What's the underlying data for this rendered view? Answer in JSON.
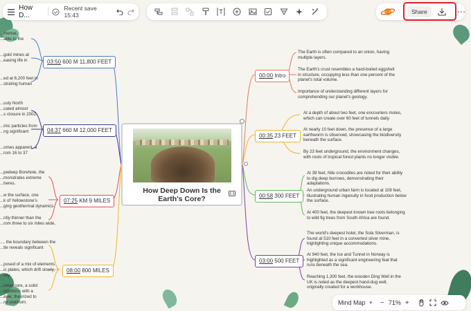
{
  "header": {
    "title": "How D...",
    "save_status": "Recent save 15:43",
    "share_label": "Share"
  },
  "central": {
    "title": "How Deep Down Is the Earth's Core?"
  },
  "right_branches": [
    {
      "time": "00:00",
      "label": "Intro",
      "color": "#e07a5f",
      "notes": [
        "The Earth is often compared to an onion, having multiple layers.",
        "The Earth's crust resembles a hard-boiled eggshell in structure, occupying less than one percent of the planet's total volume.",
        "Importance of understanding different layers for comprehending our planet's geology."
      ]
    },
    {
      "time": "00:35",
      "label": "23 FEET",
      "color": "#f0b429",
      "notes": [
        "At a depth of about two feet, one encounters moles, which can create over 60 feet of tunnels daily.",
        "At nearly 10 feet down, the presence of a large earthworm is observed, showcasing the biodiversity beneath the surface.",
        "By 23 feet underground, the environment changes, with roots of tropical forest plants no longer visible."
      ]
    },
    {
      "time": "00:58",
      "label": "300 FEET",
      "color": "#5cb85c",
      "notes": [
        "At 39 feet, Nile crocodiles are noted for their ability to dig deep burrows, demonstrating their adaptations.",
        "An underground urban farm is located at 108 feet, illustrating human ingenuity in food production below the surface.",
        "At 400 feet, the deepest known tree roots belonging to wild fig trees from South Africa are found."
      ]
    },
    {
      "time": "03:00",
      "label": "500 FEET",
      "color": "#7b3fa0",
      "notes": [
        "The world's deepest hotel, the Sola Silverman, is found at 510 feet in a converted silver mine, highlighting unique accommodations.",
        "At 940 feet, the Ice and Tunnel in Norway is highlighted as a significant engineering feat that runs beneath the sea.",
        "Reaching 1,300 feet, the wooden Ding Well in the UK is noted as the deepest hand-dug well, originally created for a workhouse."
      ]
    }
  ],
  "left_branches": [
    {
      "time": "03:50",
      "label": "600 M 11,800 FEET",
      "color": "#4a78c8",
      "notes": [
        "...mense,",
        "...able to the",
        "...",
        "...gold mines at",
        "...easing life in",
        "...",
        "...ed at 6,200 feet in",
        "...strating human"
      ]
    },
    {
      "time": "04:37",
      "label": "660 M 12,000 FEET",
      "color": "#3a3a8c",
      "notes": [
        "...usly North",
        "...cated almost",
        "...s closure in 2002.",
        "...mic particles from",
        "...ng significant",
        "...omes apparent, a",
        "...rom 16 to 37"
      ]
    },
    {
      "time": "07:25",
      "label": "KM 9 MILES",
      "color": "#e05050",
      "notes": [
        "...pedeep Borehole, the",
        "...monstrates extreme",
        "...heres.",
        "...w the surface, one",
        "...k of Yellowstone's",
        "...ging geothermal dynamics.",
        "...ntly thinner than the",
        "...rom three to six miles wide,"
      ]
    },
    {
      "time": "08:00",
      "label": "800 MILES",
      "color": "#f0b429",
      "notes": [
        "..., the boundary between the",
        "...tle reveals significant",
        "...posed of a mix of elements",
        "...ic plates, which drift slowly,",
        "...vity.",
        "...inner core, a solid",
        "...onditions with a",
        "...ayer, theorized to",
        "...nd platinum."
      ]
    }
  ],
  "footer": {
    "view_mode": "Mind Map",
    "zoom": "71%",
    "minus": "−",
    "plus": "+"
  }
}
